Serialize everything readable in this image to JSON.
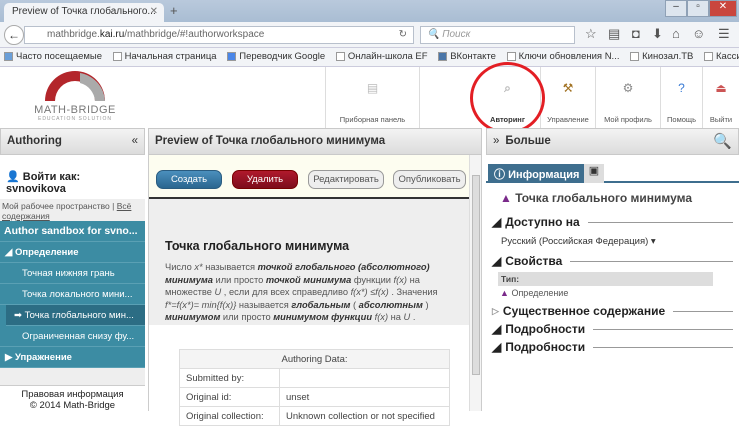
{
  "browser": {
    "tab_title": "Preview of Точка глобального...",
    "url_host": "mathbridge.",
    "url_domain": "kai.ru",
    "url_path": "/mathbridge/#!authorworkspace",
    "search_placeholder": "Поиск",
    "bookmarks": [
      "Часто посещаемые",
      "Начальная страница",
      "Переводчик Google",
      "Онлайн-школа EF",
      "ВКонтакте",
      "Ключи обновления N...",
      "Кинозал.ТВ",
      "Кассир"
    ]
  },
  "logo": {
    "name": "MATH-BRIDGE",
    "tagline": "EDUCATION SOLUTION"
  },
  "topnav": [
    {
      "label": "Приборная панель",
      "icon": "dashboard-icon"
    },
    {
      "label": "Авторинг",
      "icon": "authoring-icon"
    },
    {
      "label": "Управление",
      "icon": "management-icon"
    },
    {
      "label": "Мой профиль",
      "icon": "profile-icon"
    },
    {
      "label": "Помощь",
      "icon": "help-icon"
    },
    {
      "label": "Выйти",
      "icon": "logout-icon"
    }
  ],
  "left": {
    "title": "Authoring",
    "collapse": "«",
    "login": "Войти как: svnovikova",
    "workspace_link": "Мой рабочее пространство",
    "sep": "|",
    "all_link": "Всё содержания",
    "sandbox": "Author sandbox for svno...",
    "tree": [
      {
        "label": "Определение",
        "type": "group"
      },
      {
        "label": "Точная нижняя грань"
      },
      {
        "label": "Точка локального мини..."
      },
      {
        "label": "Точка глобального мин...",
        "active": true
      },
      {
        "label": "Ограниченная снизу фу..."
      },
      {
        "label": "Упражнение",
        "type": "group"
      }
    ],
    "legal": "Правовая информация",
    "copyright": "© 2014 Math-Bridge"
  },
  "mid": {
    "title": "Preview of Точка глобального минимума",
    "buttons": {
      "create": "Создать",
      "delete": "Удалить",
      "edit": "Редактировать",
      "publish": "Опубликовать"
    },
    "heading": "Точка глобального минимума",
    "body": [
      [
        "n",
        "Число "
      ],
      [
        "i",
        "x*"
      ],
      [
        "n",
        " называется "
      ],
      [
        "bi",
        "точкой глобального (абсолютного) минимума"
      ],
      [
        "n",
        " или просто "
      ],
      [
        "bi",
        "точкой минимума"
      ],
      [
        "n",
        " функции "
      ],
      [
        "i",
        "f(x)"
      ],
      [
        "n",
        "  на множестве "
      ],
      [
        "i",
        "U"
      ],
      [
        "n",
        " , если для всех    справедливо "
      ],
      [
        "i",
        "f(x*) ≤f(x)"
      ],
      [
        "n",
        " .  Значения "
      ],
      [
        "i",
        "f*=f(x*)= min{f(x)} "
      ],
      [
        "n",
        "   называется "
      ],
      [
        "bi",
        "глобальным"
      ],
      [
        "n",
        " ( "
      ],
      [
        "bi",
        "абсолютным"
      ],
      [
        "n",
        " ) "
      ],
      [
        "bi",
        "минимумом"
      ],
      [
        "n",
        " или просто "
      ],
      [
        "bi",
        "минимумом функции"
      ],
      [
        "i",
        " f(x)"
      ],
      [
        "n",
        "  на    "
      ],
      [
        "i",
        "U"
      ],
      [
        "n",
        " ."
      ]
    ],
    "table": {
      "header": "Authoring Data:",
      "rows": [
        [
          "Submitted by:",
          ""
        ],
        [
          "Original id:",
          "unset"
        ],
        [
          "Original collection:",
          "Unknown collection or not specified"
        ]
      ]
    }
  },
  "right": {
    "title": "Больше",
    "expand": "»",
    "tab_info": "Информация",
    "object_title": "Точка глобального минимума",
    "available": "Доступно на",
    "language": "Русский (Российская Федерация)",
    "properties": "Свойства",
    "type_label": "Тип:",
    "type_value": "Определение",
    "essential": "Существенное содержание",
    "details1": "Подробности",
    "details2": "Подробности"
  }
}
